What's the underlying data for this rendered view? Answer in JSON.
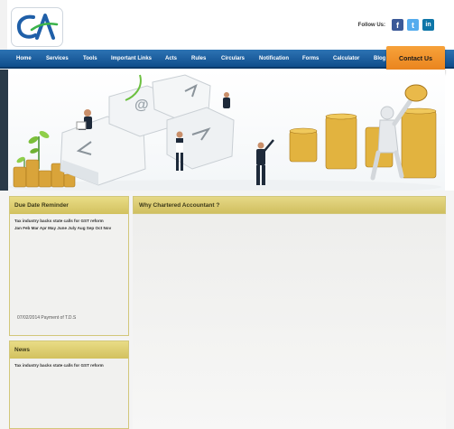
{
  "header": {
    "logo_text": "CA",
    "follow_label": "Follow Us:",
    "social": [
      {
        "name": "facebook",
        "glyph": "f",
        "color": "#3b5998"
      },
      {
        "name": "twitter",
        "glyph": "t",
        "color": "#55acee"
      },
      {
        "name": "linkedin",
        "glyph": "in",
        "color": "#0e76a8"
      }
    ]
  },
  "nav": {
    "items": [
      "Home",
      "Services",
      "Tools",
      "Important Links",
      "Acts",
      "Rules",
      "Circulars",
      "Notification",
      "Forms",
      "Calculator",
      "Blog"
    ],
    "contact_label": "Contact Us"
  },
  "due_date": {
    "title": "Due Date Reminder",
    "headline": "Tax industry backs state calls for GST reform",
    "months": "Jan Feb Mar Apr May June July Aug Sep Oct Nov",
    "footer": "07/02/2014 Payment of T.D.S"
  },
  "news": {
    "title": "News",
    "headline": "Tax industry backs state calls for GST reform"
  },
  "main": {
    "title": "Why Chartered Accountant ?"
  },
  "colors": {
    "nav": "#1a5d9c",
    "accent": "#f0922c",
    "panel_header": "#dccb6c"
  }
}
